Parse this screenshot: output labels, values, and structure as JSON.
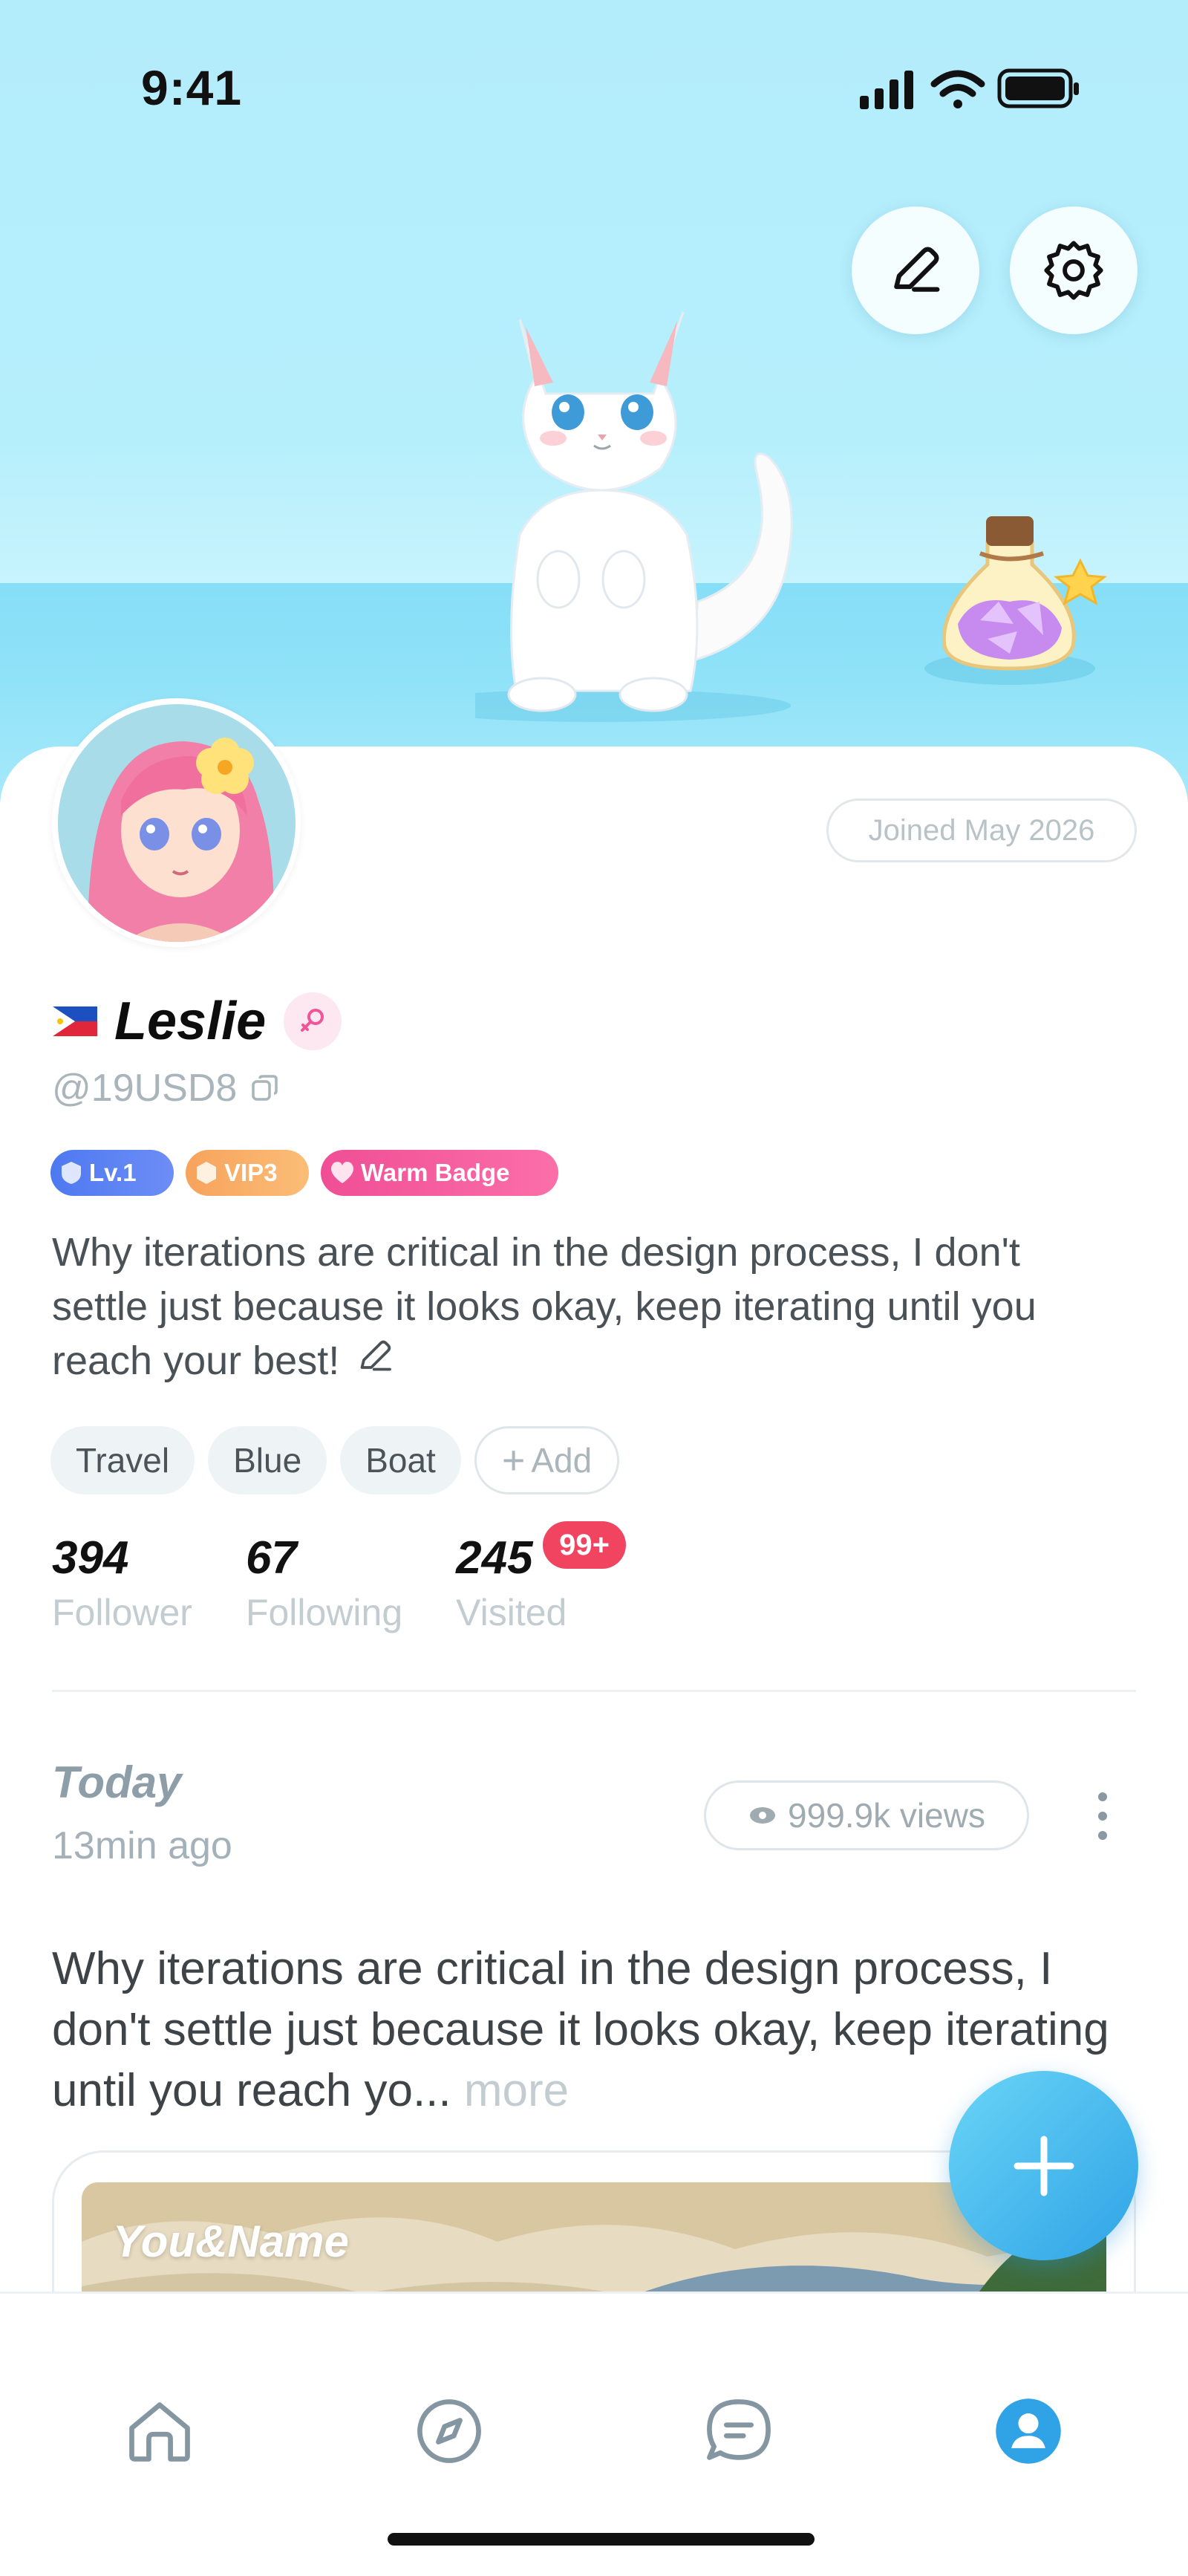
{
  "status_bar": {
    "time": "9:41"
  },
  "profile": {
    "joined": "Joined May 2026",
    "name": "Leslie",
    "handle": "@19USD8",
    "badges": [
      {
        "label": "Lv.1",
        "color": "#5b82f3"
      },
      {
        "label": "VIP3",
        "color": "#f9ad67"
      },
      {
        "label": "Warm Badge",
        "color": "#f55a9c"
      }
    ],
    "bio": "Why iterations are critical in the design process, I don't settle just because it looks okay, keep iterating until you reach your best!",
    "tags": [
      "Travel",
      "Blue",
      "Boat"
    ],
    "add_tag_label": "Add",
    "stats": [
      {
        "value": "394",
        "label": "Follower"
      },
      {
        "value": "67",
        "label": "Following"
      },
      {
        "value": "245",
        "label": "Visited",
        "badge": "99+"
      }
    ]
  },
  "post": {
    "day": "Today",
    "time_ago": "13min ago",
    "views": "999.9k views",
    "text": "Why iterations are critical in the design process, I don't settle just because it looks okay, keep iterating until you reach yo...",
    "more_label": "more",
    "image_title": "You&Name"
  },
  "tabs": [
    {
      "name": "home",
      "icon": "home-icon"
    },
    {
      "name": "discover",
      "icon": "compass-icon"
    },
    {
      "name": "messages",
      "icon": "chat-icon"
    },
    {
      "name": "profile",
      "icon": "user-icon",
      "active": true
    }
  ],
  "colors": {
    "accent": "#2fa3e6",
    "hero_bg": "#b3ecfb",
    "notification": "#f04460"
  }
}
